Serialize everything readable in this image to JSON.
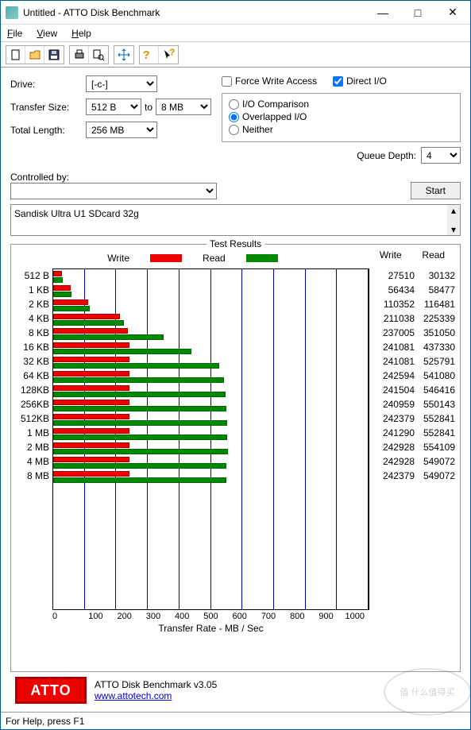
{
  "window": {
    "title": "Untitled - ATTO Disk Benchmark",
    "min": "—",
    "max": "□",
    "close": "✕"
  },
  "menu": {
    "file": "File",
    "view": "View",
    "help": "Help"
  },
  "config": {
    "drive_lbl": "Drive:",
    "drive_val": "[-c-]",
    "xfer_lbl": "Transfer Size:",
    "xfer_from": "512 B",
    "xfer_to_lbl": "to",
    "xfer_to": "8 MB",
    "len_lbl": "Total Length:",
    "len_val": "256 MB",
    "force_write": "Force Write Access",
    "direct_io": "Direct I/O",
    "io_comparison": "I/O Comparison",
    "overlapped": "Overlapped I/O",
    "neither": "Neither",
    "queue_depth_lbl": "Queue Depth:",
    "queue_depth_val": "4",
    "controlled_by_lbl": "Controlled by:",
    "start_btn": "Start",
    "note": "Sandisk Ultra U1 SDcard 32g"
  },
  "results": {
    "legend_title": "Test Results",
    "write": "Write",
    "read": "Read",
    "xlabel": "Transfer Rate - MB / Sec",
    "xmax": 1000,
    "xticks": [
      "0",
      "100",
      "200",
      "300",
      "400",
      "500",
      "600",
      "700",
      "800",
      "900",
      "1000"
    ],
    "rows": [
      {
        "label": "512 B",
        "write": 27510,
        "read": 30132
      },
      {
        "label": "1 KB",
        "write": 56434,
        "read": 58477
      },
      {
        "label": "2 KB",
        "write": 110352,
        "read": 116481
      },
      {
        "label": "4 KB",
        "write": 211038,
        "read": 225339
      },
      {
        "label": "8 KB",
        "write": 237005,
        "read": 351050
      },
      {
        "label": "16 KB",
        "write": 241081,
        "read": 437330
      },
      {
        "label": "32 KB",
        "write": 241081,
        "read": 525791
      },
      {
        "label": "64 KB",
        "write": 242594,
        "read": 541080
      },
      {
        "label": "128KB",
        "write": 241504,
        "read": 546416
      },
      {
        "label": "256KB",
        "write": 240959,
        "read": 550143
      },
      {
        "label": "512KB",
        "write": 242379,
        "read": 552841
      },
      {
        "label": "1 MB",
        "write": 241290,
        "read": 552841
      },
      {
        "label": "2 MB",
        "write": 242928,
        "read": 554109
      },
      {
        "label": "4 MB",
        "write": 242928,
        "read": 549072
      },
      {
        "label": "8 MB",
        "write": 242379,
        "read": 549072
      }
    ]
  },
  "chart_data": {
    "type": "bar",
    "title": "Test Results",
    "xlabel": "Transfer Rate - MB / Sec",
    "ylabel": "Transfer Size",
    "xlim": [
      0,
      1000
    ],
    "categories": [
      "512 B",
      "1 KB",
      "2 KB",
      "4 KB",
      "8 KB",
      "16 KB",
      "32 KB",
      "64 KB",
      "128KB",
      "256KB",
      "512KB",
      "1 MB",
      "2 MB",
      "4 MB",
      "8 MB"
    ],
    "series": [
      {
        "name": "Write",
        "color": "#e00000",
        "unit": "KB/s",
        "values": [
          27510,
          56434,
          110352,
          211038,
          237005,
          241081,
          241081,
          242594,
          241504,
          240959,
          242379,
          241290,
          242928,
          242928,
          242379
        ]
      },
      {
        "name": "Read",
        "color": "#008800",
        "unit": "KB/s",
        "values": [
          30132,
          58477,
          116481,
          225339,
          351050,
          437330,
          525791,
          541080,
          546416,
          550143,
          552841,
          552841,
          554109,
          549072,
          549072
        ]
      }
    ]
  },
  "footer": {
    "logo": "ATTO",
    "product": "ATTO Disk Benchmark v3.05",
    "url": "www.attotech.com"
  },
  "status": "For Help, press F1"
}
